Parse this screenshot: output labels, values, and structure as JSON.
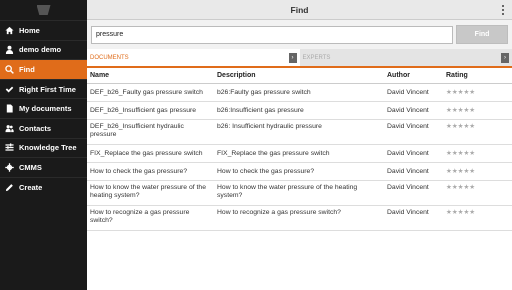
{
  "header": {
    "title": "Find"
  },
  "sidebar": {
    "items": [
      {
        "label": "Home",
        "icon": "home-icon"
      },
      {
        "label": "demo demo",
        "icon": "user-icon"
      },
      {
        "label": "Find",
        "icon": "search-icon",
        "active": true
      },
      {
        "label": "Right First Time",
        "icon": "check-icon"
      },
      {
        "label": "My documents",
        "icon": "document-icon"
      },
      {
        "label": "Contacts",
        "icon": "contacts-icon"
      },
      {
        "label": "Knowledge Tree",
        "icon": "tree-icon"
      },
      {
        "label": "CMMS",
        "icon": "gear-icon"
      },
      {
        "label": "Create",
        "icon": "pencil-icon"
      }
    ]
  },
  "search": {
    "value": "pressure",
    "button_label": "Find"
  },
  "tabs": [
    {
      "label": "DOCUMENTS",
      "active": true
    },
    {
      "label": "EXPERTS",
      "active": false
    }
  ],
  "table": {
    "headers": [
      "Name",
      "Description",
      "Author",
      "Rating"
    ],
    "rows": [
      {
        "name": "DEF_b26_Faulty gas pressure switch",
        "desc": "b26:Faulty gas pressure switch",
        "author": "David Vincent",
        "rating": "★★★★★"
      },
      {
        "name": "DEF_b26_Insufficient gas pressure",
        "desc": "b26:Insufficient gas pressure",
        "author": "David Vincent",
        "rating": "★★★★★"
      },
      {
        "name": "DEF_b26_Insufficient hydraulic pressure",
        "desc": "b26: Insufficient hydraulic pressure",
        "author": "David Vincent",
        "rating": "★★★★★"
      },
      {
        "name": "FIX_Replace the gas pressure switch",
        "desc": "FIX_Replace the gas pressure switch",
        "author": "David Vincent",
        "rating": "★★★★★"
      },
      {
        "name": "How to check the gas pressure?",
        "desc": "How to check the gas pressure?",
        "author": "David Vincent",
        "rating": "★★★★★"
      },
      {
        "name": "How to know the water pressure of the heating system?",
        "desc": "How to know the water pressure of the heating system?",
        "author": "David Vincent",
        "rating": "★★★★★"
      },
      {
        "name": "How to recognize a gas pressure switch?",
        "desc": "How to recognize a gas pressure switch?",
        "author": "David Vincent",
        "rating": "★★★★★"
      }
    ]
  },
  "colors": {
    "accent": "#e06c1a",
    "sidebar_bg": "#1a1a1a"
  }
}
